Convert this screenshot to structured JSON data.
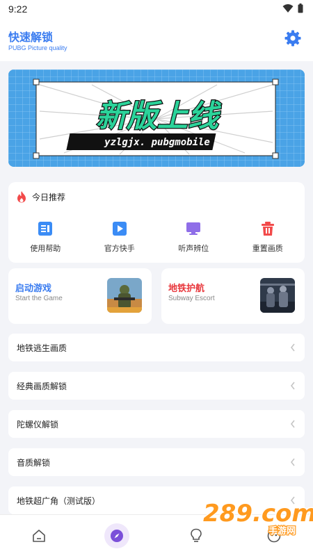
{
  "status_bar": {
    "time": "9:22"
  },
  "header": {
    "title": "快速解锁",
    "subtitle": "PUBG Picture quality"
  },
  "banner": {
    "headline": "新版上线",
    "tagline": "yzlgjx. pubgmobile"
  },
  "recommend": {
    "title": "今日推荐",
    "items": [
      {
        "label": "使用帮助",
        "icon": "help-doc-icon",
        "color": "#3b8cf5"
      },
      {
        "label": "官方快手",
        "icon": "video-play-icon",
        "color": "#3b8cf5"
      },
      {
        "label": "听声辨位",
        "icon": "monitor-icon",
        "color": "#8f6ee8"
      },
      {
        "label": "重置画质",
        "icon": "trash-icon",
        "color": "#f24a4a"
      }
    ]
  },
  "games": [
    {
      "title": "启动游戏",
      "subtitle": "Start the Game",
      "title_color": "#3a7cf0"
    },
    {
      "title": "地铁护航",
      "subtitle": "Subway Escort",
      "title_color": "#e8383d"
    }
  ],
  "list": [
    {
      "label": "地铁逃生画质"
    },
    {
      "label": "经典画质解锁"
    },
    {
      "label": "陀螺仪解锁"
    },
    {
      "label": "音质解锁"
    },
    {
      "label": "地铁超广角（测试版）"
    }
  ],
  "tabs": [
    {
      "icon": "home-icon",
      "active": false
    },
    {
      "icon": "compass-icon",
      "active": true
    },
    {
      "icon": "lightbulb-icon",
      "active": false
    },
    {
      "icon": "face-icon",
      "active": false
    }
  ],
  "watermark": {
    "text": "289.com",
    "sub": "手游网"
  },
  "colors": {
    "accent": "#3a7cf0",
    "background": "#f3f4f8",
    "active_tab": "#7b4fd9"
  }
}
